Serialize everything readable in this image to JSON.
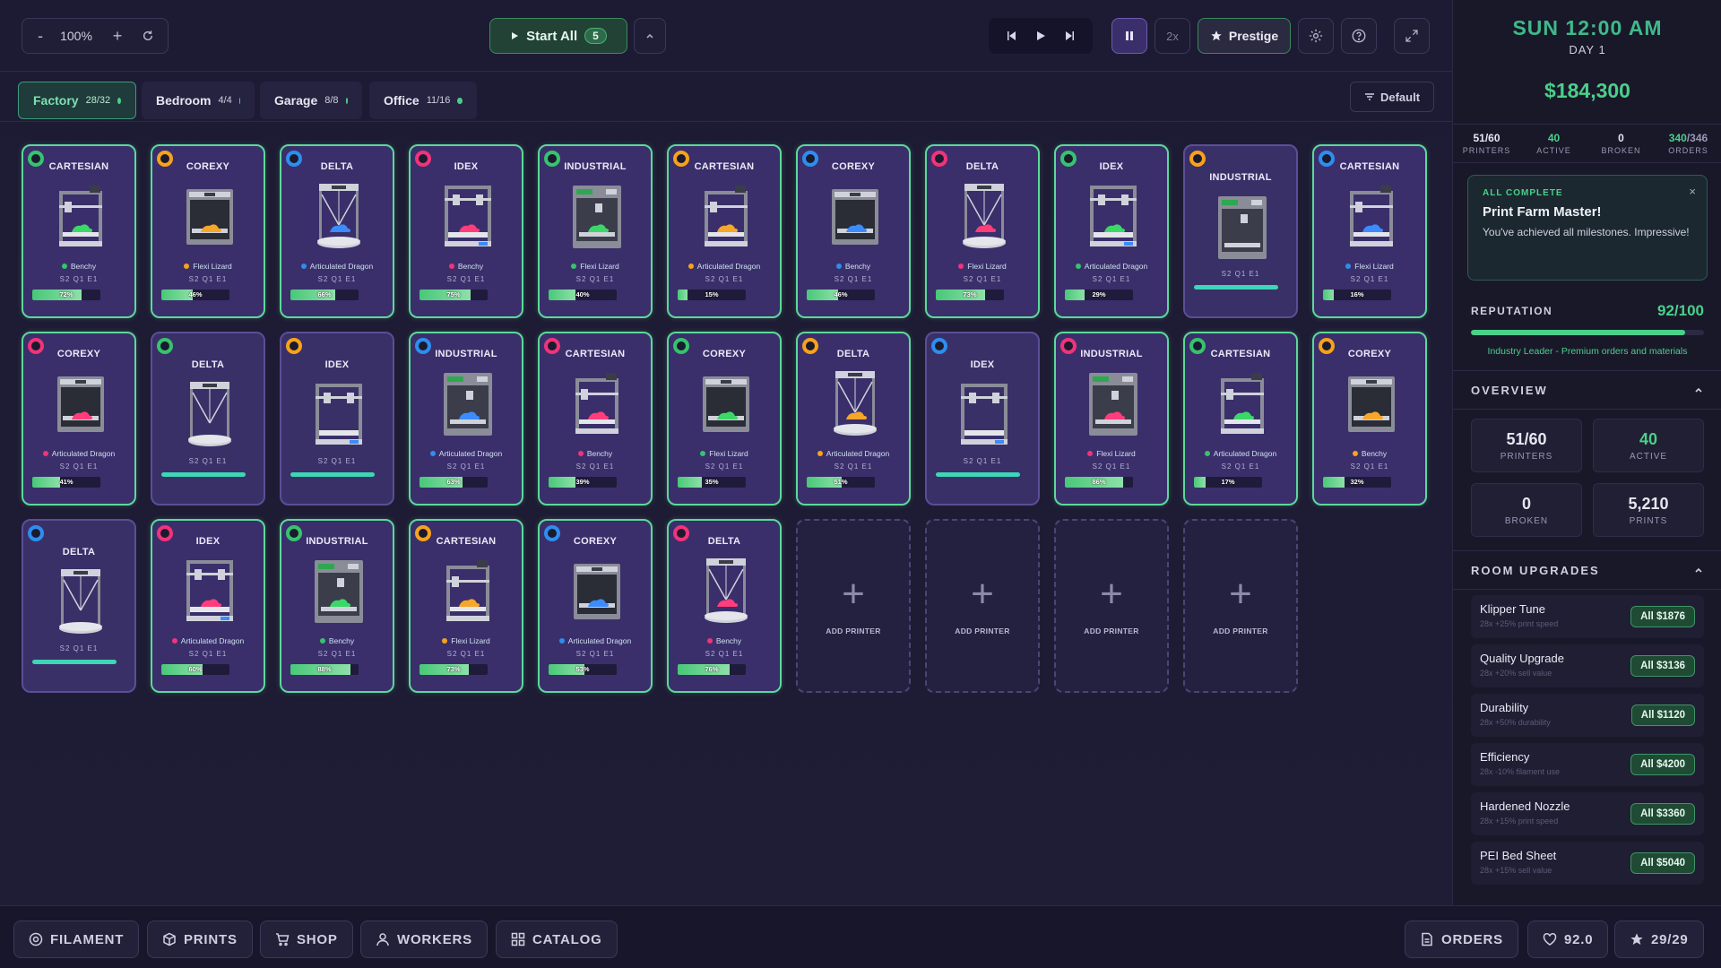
{
  "toolbar": {
    "zoom_out": "-",
    "zoom": "100%",
    "zoom_in": "+",
    "start_all": "Start All",
    "start_count": "5",
    "speed": "2x",
    "prestige": "Prestige"
  },
  "tabs": [
    {
      "label": "Factory",
      "count": "28/32"
    },
    {
      "label": "Bedroom",
      "count": "4/4"
    },
    {
      "label": "Garage",
      "count": "8/8"
    },
    {
      "label": "Office",
      "count": "11/16"
    }
  ],
  "sort": "Default",
  "add_label": "ADD PRINTER",
  "printers": [
    {
      "type": "CARTESIAN",
      "color": "#35c46e",
      "model": "Benchy",
      "stats": "S2 Q1 E1",
      "progress": 72,
      "pct": "72%"
    },
    {
      "type": "COREXY",
      "color": "#f7a21b",
      "model": "Flexi Lizard",
      "stats": "S2 Q1 E1",
      "progress": 46,
      "pct": "46%"
    },
    {
      "type": "DELTA",
      "color": "#2d8ef0",
      "model": "Articulated Dragon",
      "stats": "S2 Q1 E1",
      "progress": 66,
      "pct": "66%"
    },
    {
      "type": "IDEX",
      "color": "#f0337a",
      "model": "Benchy",
      "stats": "S2 Q1 E1",
      "progress": 75,
      "pct": "75%"
    },
    {
      "type": "INDUSTRIAL",
      "color": "#35c46e",
      "model": "Flexi Lizard",
      "stats": "S2 Q1 E1",
      "progress": 40,
      "pct": "40%"
    },
    {
      "type": "CARTESIAN",
      "color": "#f7a21b",
      "model": "Articulated Dragon",
      "stats": "S2 Q1 E1",
      "progress": 15,
      "pct": "15%"
    },
    {
      "type": "COREXY",
      "color": "#2d8ef0",
      "model": "Benchy",
      "stats": "S2 Q1 E1",
      "progress": 46,
      "pct": "46%"
    },
    {
      "type": "DELTA",
      "color": "#f0337a",
      "model": "Flexi Lizard",
      "stats": "S2 Q1 E1",
      "progress": 73,
      "pct": "73%"
    },
    {
      "type": "IDEX",
      "color": "#35c46e",
      "model": "Articulated Dragon",
      "stats": "S2 Q1 E1",
      "progress": 29,
      "pct": "29%"
    },
    {
      "type": "INDUSTRIAL",
      "color": "#f7a21b",
      "idle": true,
      "stats": "S2 Q1 E1"
    },
    {
      "type": "CARTESIAN",
      "color": "#2d8ef0",
      "model": "Flexi Lizard",
      "stats": "S2 Q1 E1",
      "progress": 16,
      "pct": "16%"
    },
    {
      "type": "COREXY",
      "color": "#f0337a",
      "model": "Articulated Dragon",
      "stats": "S2 Q1 E1",
      "progress": 41,
      "pct": "41%"
    },
    {
      "type": "DELTA",
      "color": "#35c46e",
      "idle": true,
      "stats": "S2 Q1 E1"
    },
    {
      "type": "IDEX",
      "color": "#f7a21b",
      "idle": true,
      "stats": "S2 Q1 E1"
    },
    {
      "type": "INDUSTRIAL",
      "color": "#2d8ef0",
      "model": "Articulated Dragon",
      "stats": "S2 Q1 E1",
      "progress": 63,
      "pct": "63%"
    },
    {
      "type": "CARTESIAN",
      "color": "#f0337a",
      "model": "Benchy",
      "stats": "S2 Q1 E1",
      "progress": 39,
      "pct": "39%"
    },
    {
      "type": "COREXY",
      "color": "#35c46e",
      "model": "Flexi Lizard",
      "stats": "S2 Q1 E1",
      "progress": 35,
      "pct": "35%"
    },
    {
      "type": "DELTA",
      "color": "#f7a21b",
      "model": "Articulated Dragon",
      "stats": "S2 Q1 E1",
      "progress": 51,
      "pct": "51%"
    },
    {
      "type": "IDEX",
      "color": "#2d8ef0",
      "idle": true,
      "stats": "S2 Q1 E1"
    },
    {
      "type": "INDUSTRIAL",
      "color": "#f0337a",
      "model": "Flexi Lizard",
      "stats": "S2 Q1 E1",
      "progress": 86,
      "pct": "86%"
    },
    {
      "type": "CARTESIAN",
      "color": "#35c46e",
      "model": "Articulated Dragon",
      "stats": "S2 Q1 E1",
      "progress": 17,
      "pct": "17%"
    },
    {
      "type": "COREXY",
      "color": "#f7a21b",
      "model": "Benchy",
      "stats": "S2 Q1 E1",
      "progress": 32,
      "pct": "32%"
    },
    {
      "type": "DELTA",
      "color": "#2d8ef0",
      "idle": true,
      "stats": "S2 Q1 E1"
    },
    {
      "type": "IDEX",
      "color": "#f0337a",
      "model": "Articulated Dragon",
      "stats": "S2 Q1 E1",
      "progress": 60,
      "pct": "60%"
    },
    {
      "type": "INDUSTRIAL",
      "color": "#35c46e",
      "model": "Benchy",
      "stats": "S2 Q1 E1",
      "progress": 88,
      "pct": "88%"
    },
    {
      "type": "CARTESIAN",
      "color": "#f7a21b",
      "model": "Flexi Lizard",
      "stats": "S2 Q1 E1",
      "progress": 73,
      "pct": "73%"
    },
    {
      "type": "COREXY",
      "color": "#2d8ef0",
      "model": "Articulated Dragon",
      "stats": "S2 Q1 E1",
      "progress": 53,
      "pct": "53%"
    },
    {
      "type": "DELTA",
      "color": "#f0337a",
      "model": "Benchy",
      "stats": "S2 Q1 E1",
      "progress": 76,
      "pct": "76%"
    }
  ],
  "side": {
    "clock": "SUN 12:00 AM",
    "day": "DAY 1",
    "money": "$184,300",
    "quick": [
      {
        "value": "51/60",
        "label": "PRINTERS"
      },
      {
        "value": "40",
        "label": "ACTIVE"
      },
      {
        "value": "0",
        "label": "BROKEN"
      },
      {
        "value": "340",
        "value2": "/346",
        "label": "ORDERS"
      }
    ],
    "banner": {
      "kicker": "ALL COMPLETE",
      "title": "Print Farm Master!",
      "text": "You've achieved all milestones. Impressive!",
      "close": "×"
    },
    "reputation": {
      "label": "REPUTATION",
      "value": "92/100",
      "fraction": 0.92,
      "note": "Industry Leader - Premium orders and materials"
    },
    "overview": {
      "title": "OVERVIEW",
      "boxes": [
        {
          "value": "51/60",
          "label": "PRINTERS"
        },
        {
          "value": "40",
          "label": "ACTIVE"
        },
        {
          "value": "0",
          "label": "BROKEN"
        },
        {
          "value": "5,210",
          "label": "PRINTS"
        }
      ]
    },
    "upgrades": {
      "title": "ROOM UPGRADES",
      "items": [
        {
          "name": "Klipper Tune",
          "desc": "28x +25% print speed",
          "button": "All $1876"
        },
        {
          "name": "Quality Upgrade",
          "desc": "28x +20% sell value",
          "button": "All $3136"
        },
        {
          "name": "Durability",
          "desc": "28x +50% durability",
          "button": "All $1120"
        },
        {
          "name": "Efficiency",
          "desc": "28x -10% filament use",
          "button": "All $4200"
        },
        {
          "name": "Hardened Nozzle",
          "desc": "28x +15% print speed",
          "button": "All $3360"
        },
        {
          "name": "PEI Bed Sheet",
          "desc": "28x +15% sell value",
          "button": "All $5040"
        }
      ]
    }
  },
  "bottom": {
    "filament": "FILAMENT",
    "prints": "PRINTS",
    "shop": "SHOP",
    "workers": "WORKERS",
    "catalog": "CATALOG",
    "orders": "ORDERS",
    "hearts": "92.0",
    "stars": "29/29"
  }
}
